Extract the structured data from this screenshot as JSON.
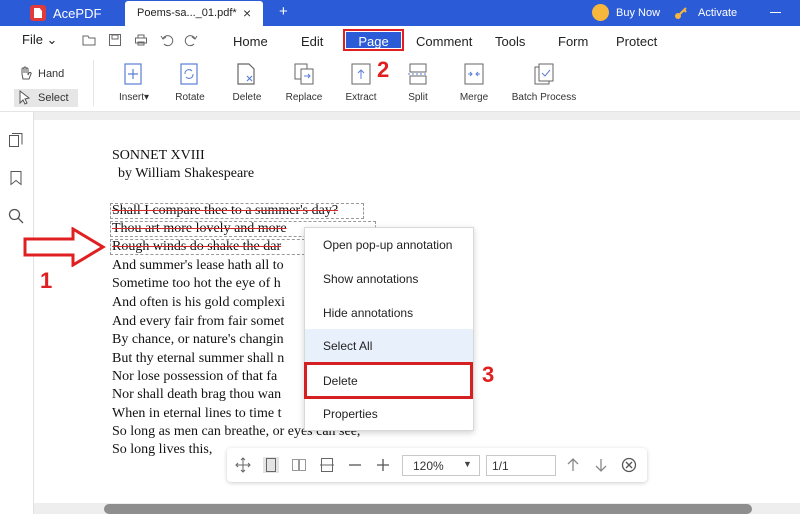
{
  "titlebar": {
    "app_name": "AcePDF",
    "doc_tab": "Poems-sa..._01.pdf*",
    "tab_close": "×",
    "new_tab": "+",
    "buy_now": "Buy Now",
    "activate": "Activate"
  },
  "menubar": {
    "file": "File ⌄",
    "tabs": [
      "Home",
      "Edit",
      "Page",
      "Comment",
      "Tools",
      "Form",
      "Protect"
    ],
    "active_tab": "Page"
  },
  "toolbar": {
    "hand": "Hand",
    "select": "Select",
    "tools": [
      "Insert▾",
      "Rotate",
      "Delete",
      "Replace",
      "Extract",
      "Split",
      "Merge",
      "Batch Process"
    ]
  },
  "document": {
    "title": "SONNET XVIII",
    "author": "by William Shakespeare",
    "lines": [
      "Shall I compare thee to a summer's day?",
      "Thou art more lovely and more",
      "Rough winds do shake the dar",
      "And summer's lease hath all to",
      "Sometime too hot the eye of h",
      "And often is his gold complexi",
      "And every fair from fair somet",
      "By chance, or nature's changin",
      "But thy eternal summer shall n",
      "Nor lose possession of that fa",
      "Nor shall death brag thou wan",
      "When in eternal lines to time t",
      "So long as men can breathe, or eyes can see,",
      "So long lives this,"
    ]
  },
  "context_menu": {
    "items": [
      "Open pop-up annotation",
      "Show annotations",
      "Hide annotations",
      "Select All",
      "Delete",
      "Properties"
    ],
    "hovered": "Select All",
    "highlighted": "Delete"
  },
  "callouts": [
    "1",
    "2",
    "3"
  ],
  "bottombar": {
    "zoom": "120%",
    "page": "1/1"
  },
  "colors": {
    "brand": "#2b5bd7",
    "callout_red": "#e02020",
    "strike_red": "#d32b2b",
    "hover_bg": "#e8f0fb"
  }
}
